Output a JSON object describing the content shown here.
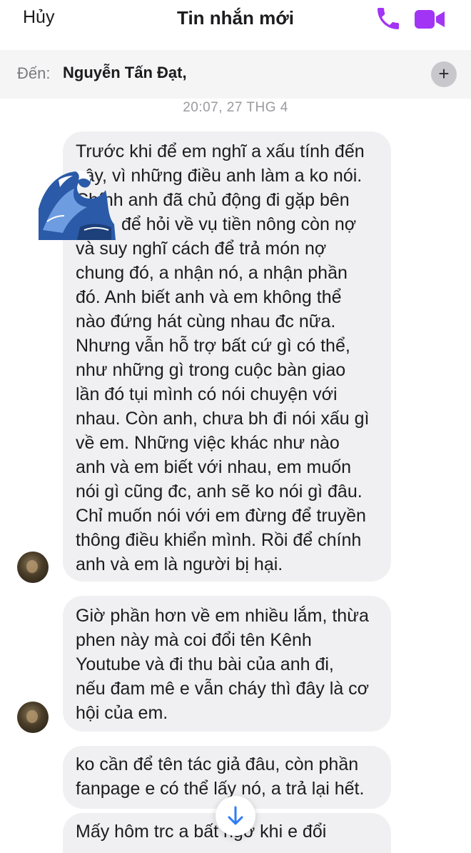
{
  "header": {
    "cancel_label": "Hủy",
    "title": "Tin nhắn mới",
    "phone_icon": "phone-icon",
    "video_icon": "video-camera-icon",
    "accent_color": "#a234f5"
  },
  "to_bar": {
    "label": "Đến:",
    "recipient": "Nguyễn Tấn Đạt,",
    "add_icon": "plus-icon",
    "add_label": "+"
  },
  "timestamp": "20:07, 27 THG 4",
  "messages": [
    {
      "lines": [
        "Trước khi để em nghĩ a xấu tính đến",
        "vậy, vì những điều anh làm a ko nói.",
        "Chính anh đã chủ động đi gặp bên",
        "để hỏi về vụ tiền nông còn nợ",
        "và suy nghĩ cách để trả món nợ",
        "chung đó, a nhận nó, a nhận phần",
        "đó. Anh biết anh và em không thể",
        "nào đứng hát cùng nhau đc nữa.",
        "Nhưng vẫn hỗ trợ bất cứ gì có thể,",
        "như những gì trong cuộc bàn giao",
        "lần đó tụi mình có nói chuyện với",
        "nhau. Còn anh, chưa bh đi nói xấu gì",
        "về em. Những việc khác như nào",
        "anh và em biết với nhau, em muốn",
        "nói gì cũng đc, anh sẽ ko nói gì đâu.",
        "Chỉ muốn nói với em đừng để truyền",
        "thông điều khiển mình. Rồi để chính",
        "anh và em là người bị hại."
      ]
    },
    {
      "lines": [
        "Giờ phần hơn về em nhiều lắm, thừa",
        "phen này mà coi đổi tên Kênh",
        "Youtube và đi thu bài của anh đi,",
        "nếu đam mê e vẫn cháy thì đây là cơ",
        "hội của em."
      ]
    },
    {
      "lines": [
        "ko cần để tên tác giả đâu, còn phần",
        "fanpage e có thể lấy nó, a trả lại hết."
      ]
    },
    {
      "lines": [
        "Mấy hôm trc a bất ngờ khi e đổi"
      ]
    }
  ],
  "sticker_icon": "great-wave-sticker-icon",
  "avatar_icon": "contact-avatar",
  "scroll_icon": "arrow-down-icon"
}
